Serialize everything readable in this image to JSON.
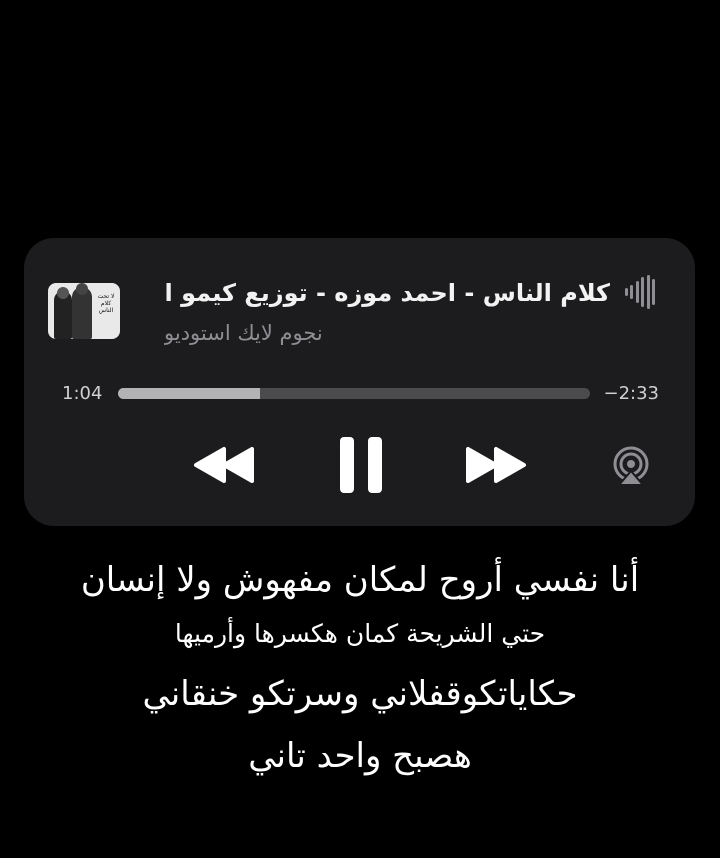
{
  "now_playing": {
    "title": "كلام الناس - احمد موزه - توزيع كيمو الديب",
    "artist": "نجوم لايك استوديو",
    "artwork": {
      "label": "لا تحت كلام الناس"
    },
    "elapsed": "1:04",
    "remaining": "−2:33",
    "progress": 0.3
  },
  "controls": {
    "rewind_icon": "rewind-icon",
    "pause_icon": "pause-icon",
    "forward_icon": "fast-forward-icon",
    "airplay_icon": "airplay-audio-icon",
    "waveform_icon": "audio-waveform-icon"
  },
  "lyrics": [
    "أنا نفسي أروح لمكان مفهوش ولا إنسان",
    "حتي الشريحة كمان هكسرها وأرميها",
    "حكاياتكوقفلاني وسرتكو خنقاني",
    "هصبح واحد تاني"
  ],
  "colors": {
    "background": "#000000",
    "card": "#1c1c1e",
    "progress_fill": "#b3b3b6",
    "progress_track": "#4b4b4e"
  }
}
